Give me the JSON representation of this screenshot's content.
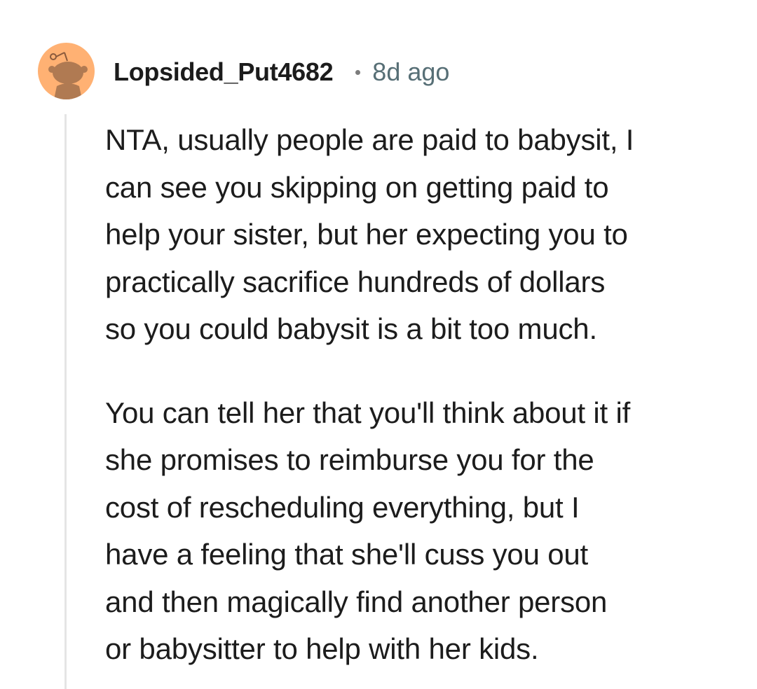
{
  "comment": {
    "author": "Lopsided_Put4682",
    "separator": "•",
    "timestamp": "8d ago",
    "avatar_icon": "snoo-avatar-icon",
    "avatar_color": "#ffb173",
    "paragraphs": [
      "NTA, usually people are paid to babysit, I\ncan see you skipping on getting paid to\nhelp your sister, but her expecting you to\npractically sacrifice hundreds of dollars\nso you could babysit is a bit too much.",
      "You can tell her that you'll think about it if\nshe promises to reimburse you for the\ncost of rescheduling everything, but I\nhave a feeling that she'll cuss you out\nand then magically find another person\nor babysitter to help with her kids."
    ]
  }
}
